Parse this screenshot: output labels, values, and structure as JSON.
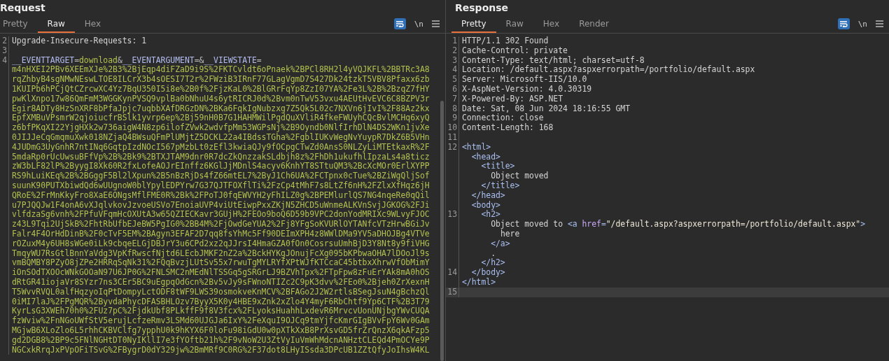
{
  "request": {
    "title": "Request",
    "tabs": [
      {
        "label": "Pretty",
        "selected": false
      },
      {
        "label": "Raw",
        "selected": true
      },
      {
        "label": "Hex",
        "selected": false
      }
    ],
    "toolbar": {
      "wrap_on": true,
      "newline_label": "\\n"
    },
    "lines": [
      {
        "number": "2",
        "parts": [
          {
            "text": "Upgrade-Insecure-Requests: 1"
          }
        ]
      },
      {
        "number": "3"
      },
      {
        "number": "4",
        "parts": [
          {
            "kind": "key",
            "text": "__EVENTTARGET"
          },
          {
            "kind": "op",
            "text": "="
          },
          {
            "kind": "value",
            "text": "download"
          },
          {
            "kind": "op",
            "text": "&"
          },
          {
            "kind": "key",
            "text": "__EVENTARGUMENT"
          },
          {
            "kind": "op",
            "text": "=&"
          },
          {
            "kind": "key",
            "text": "__VIEWSTATE"
          },
          {
            "kind": "op",
            "text": "="
          }
        ],
        "wrapped": [
          "m4nHXEI2PBv6XEEmXJe%2B3%2BjEqp4diFZaD9i9S%2FKTCvldt6oPnaek%2BPCl8RH2l4yVQJKFL%2BBTRc3A8",
          "rqZhbyB4sgNMwNEswLTOE8ILCrX3b4sOESI7T2r%2FWziB3IRnF77GLagVgmD7S427Dk24tzkT5VBV8Pfaxx6zb",
          "1KUIPb6hPCjQtCZrcwXC4Yz7BqU350I5i8e%2B0f%2FjzKaL0%2BlGRrFqYp8ZzI07YA%2Fe3L%2B%2BzqZ7fHY",
          "pwKlXnpo17w86QmFmM3WGGKynPVSQ9vplBa0bNhuU4s6ytRICRJ0d%2Bvm0nTwV53vxu4AEUtHvEVC6C8BZPV3r",
          "Egir8ADTy8HzSnXRF8bPfaJpjc7uqbbXAfDRGzDN%2BKa6FqkIgNubzxg7Z5Qk5L02c7NXVn6jIvI%2F88Az2kx",
          "EpfXMBuVPsmrW2qjoiucfrBSlk1yvrp6ep%2Bj59nH0B7G1HAHMWilPgdQuXVliR4fkeFWUyhCQcBvlMCHq6xyQ",
          "z6bfPKqXI22YjgHXk2w736aigW4N8zp6ilofZVwk2wdvfpMm53WGPsNj%2B9Oyndb0NlfIrhDlN4DS2WKn1jvXe",
          "0JIJJeCqGmqmuXwk018NZjaQ4BWsuQFmPlUMjtZ5DCKL22a4IBdssTGha%2FgblIUKvWegNvYuypR7DkZ6B5VHn",
          "4JUDmG3UyGnhR7ntINq6GqtpIzdNOcI567pMzbLt0zEfl3kwiaQJy9fOCpgCTwZd0AnsS0NLZyLiMTEtkaxR%2F",
          "5mdaRp0rUcUwsuBFfVp%2B%2Bk9%2BTXJTAM9dnr0R7dcZkQnzzakSLdbjh8z%2FhDh1ukufhlIpzaLs4a8ticz",
          "zW3bLF82lP%2ByygI8Xk60R2fxLofeAOJrEInffz6KGlJjMDnlS4acyv6KnhYT8STtuQM3%2BcXcMOr0ErlXYPP",
          "RS9hLuiKEq%2B%2BGggF5Bl2lXpun%2B5nBzRjDs4fZ66mtEL7%2ByJ1Ch6UA%2FCTpnx0cTue%2BZiWgQljSof",
          "suunK90PUTXbiwdQd6wUUgnoW0blYpylEDPYrw7G37QJTFOXflTi%2FzCp4tMhF7s8LtZf6nH%2FZlxXfHqz6jH",
          "QRoE%2FrMnKkyFro8XaE6ONgsMflFME0R%2Bk%2FPoTJ0fqEWVYH2yFhILZ0g%2BPEMlurlQS7NG4nqeRe0qQil",
          "u7PJQQJw1F4onA6vXJqlvkovJzvoeUSVo7EnoiaUVP4viUtEiwpPxxZKjN5ZHCD5uWnmeALKVnSvjJGKOG%2FJi",
          "vlfdzaSg6vnh%2FPfuVFqmHcOXUtA3w65QZIECKavr3GUjH%2FEOo9boQ6D59b9VPC2donYodMRIXc9WLvyFJOC",
          "z43L9Tqi2UjSkB%2FhtRbUfbEJeBW5PgIG0%2BB4M%2FjOwdGeYUA2%2Fj8YFgSoKVURlOYTANfcVTzHrwBGiJv",
          "Falr4F4OrHdDinB%2F0cTvF5EM%2BAgyn3EFAF2D7qq8fsYhMc5Ff90DEImXPH4z8WWlDMa9YV5aDHOJBg4VTVe",
          "rOZuxM4y6UH8sWGe0iLk9cbqeELGjDBJrY3u6CPd2xz2qJJrsI4HmaGZA0fOn0CosrsuUmhBjD3Y8Nt8y9fiVHG",
          "TmqyWU7RsGtlBnnYaVdg3VpKfRwscfNjtd6LEcbJMKF2nZ2a%2BckHYKgJOnujFcXg095bKPbwaOHA7lDOoJl9s",
          "vmBQMBY8PZyO8jZPe2HRRqSqNk31%2FQqBvzjLUtSv55x7rwuTgMYLRYfXPtWJfKTCcaC45btbxXhrwVfObMimY",
          "iOnSOdTXOOcWNkGOOaN97U6JP0G%2FNLSMC2nMEdNlTSSGq5gSRGrLJ9BZVhTpx%2FTpFpw8zFuErYAk8mA0hOS",
          "dRtGR41iojaVr8SYzr7ns3CEr5BC9uEgpqOdGcn%2Bv5vJy9sFWnoNTIZc2C9pK3dvv%2FEo0%2Bjeh0ZrXexnH",
          "T5WvvRVQL0alfHqzyoIqPtDompyLctODF8tWF9LWS39osmokveKnMCV%2BFAGo2J2W2rtlsBSegJsuN4gBchzQl",
          "0iMI7laJ%2FPgMQR%2ByvdaPhycDFASBHLOzv7ByyX5K0y4HBE9xZnk2xZlo4Y4myF6RbChtf9Yp6CTF%2B3T79",
          "KyrLsG3XWEh70h0%2FUz7pC%2FjdkUbf8PLkffF9f8V3fcx%2FLyoksHuahhLxdevR6MrvcvUonUNjbgYWvCUQA",
          "fzWviw%2FnNGoUWfStV5erujLcfzeRmv3LSMd60UJGJa6IxY%2FeXquI9OJCq9tmYjfcKmrGIgBVvFpY6Wv0GAm",
          "MGjwB6XLoZlo6L5rhhCKBVClfg7ypphU0k9hKYX6F0loFu98iGdU0w0pXTkXxB8PrXsvGD5frZrQnzX6qkAFzp5",
          "gd2DGB8%2BP9c5FNlNGHtDT0NyIKllI7e3fYOftb21h%2F9vNoW2U3ZtVyIuVmWhMdcnANHztCLEQd4PmOCYe9P",
          "NGCxkRrqJxPVpOFiTSvG%2FBygrD0dY329jw%2BmMRf9C0RG%2F37dot8LHyISsda3DPcUB1ZZtQfyJoIhsW4KL"
        ]
      }
    ]
  },
  "response": {
    "title": "Response",
    "tabs": [
      {
        "label": "Pretty",
        "selected": true
      },
      {
        "label": "Raw",
        "selected": false
      },
      {
        "label": "Hex",
        "selected": false
      },
      {
        "label": "Render",
        "selected": false
      }
    ],
    "toolbar": {
      "wrap_on": true,
      "newline_label": "\\n"
    },
    "headers": [
      {
        "number": "1",
        "text": "HTTP/1.1 302 Found"
      },
      {
        "number": "2",
        "text": "Cache-Control: private"
      },
      {
        "number": "3",
        "text": "Content-Type: text/html; charset=utf-8"
      },
      {
        "number": "4",
        "text": "Location: /default.aspx?aspxerrorpath=/portfolio/default.aspx"
      },
      {
        "number": "5",
        "text": "Server: Microsoft-IIS/10.0"
      },
      {
        "number": "6",
        "text": "X-AspNet-Version: 4.0.30319"
      },
      {
        "number": "7",
        "text": "X-Powered-By: ASP.NET"
      },
      {
        "number": "8",
        "text": "Date: Sat, 08 Jun 2024 18:16:55 GMT"
      },
      {
        "number": "9",
        "text": "Connection: close"
      },
      {
        "number": "10",
        "text": "Content-Length: 168"
      },
      {
        "number": "11"
      }
    ],
    "body": [
      {
        "number": "12",
        "open": [
          {
            "kind": "tag",
            "text": "<html>"
          }
        ],
        "close": "</html>",
        "children": [
          {
            "open": [
              {
                "kind": "tag",
                "text": "<head>"
              }
            ],
            "close": "</head>",
            "children": [
              {
                "open": [
                  {
                    "kind": "tag",
                    "text": "<title>"
                  }
                ],
                "close": "</title>",
                "children": [
                  {
                    "open": [
                      {
                        "text": "Object moved"
                      }
                    ]
                  }
                ]
              }
            ]
          },
          {
            "open": [
              {
                "kind": "tag",
                "text": "<body>"
              }
            ],
            "close": "</body>",
            "close_number": "14",
            "children": [
              {
                "number": "13",
                "open": [
                  {
                    "kind": "tag",
                    "text": "<h2>"
                  }
                ],
                "close": "</h2>",
                "children": [
                  {
                    "open": [
                      {
                        "text": "Object moved to "
                      },
                      {
                        "kind": "tag",
                        "text": "<a "
                      },
                      {
                        "kind": "attr",
                        "text": "href"
                      },
                      {
                        "kind": "tag",
                        "text": "="
                      },
                      {
                        "kind": "string",
                        "text": "\"/default.aspx?aspxerrorpath=/portfolio/default.aspx\""
                      },
                      {
                        "kind": "tag",
                        "text": ">"
                      }
                    ],
                    "close": "</a>",
                    "children": [
                      {
                        "open": [
                          {
                            "text": "here"
                          }
                        ]
                      }
                    ]
                  },
                  {
                    "open": [
                      {
                        "text": "."
                      }
                    ]
                  }
                ]
              }
            ]
          }
        ]
      },
      {
        "number": "15",
        "current": true
      }
    ]
  }
}
